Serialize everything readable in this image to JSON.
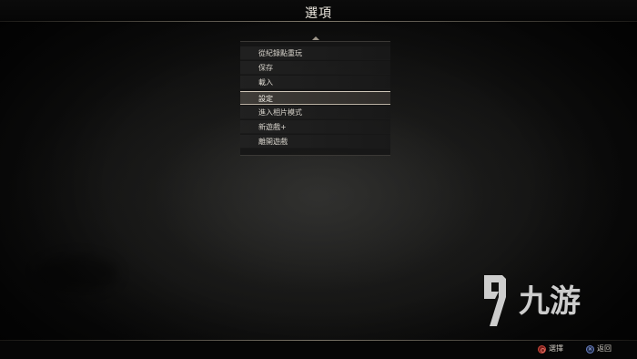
{
  "page": {
    "title": "選項"
  },
  "menu": {
    "items": [
      {
        "label": "從紀錄點重玩",
        "selected": false
      },
      {
        "label": "保存",
        "selected": false
      },
      {
        "label": "載入",
        "selected": false
      },
      {
        "label": "設定",
        "selected": true
      },
      {
        "label": "進入相片模式",
        "selected": false
      },
      {
        "label": "新遊戲+",
        "selected": false
      },
      {
        "label": "離開遊戲",
        "selected": false
      }
    ]
  },
  "hints": {
    "select_icon": "circle-button-icon",
    "select_label": "選擇",
    "back_icon": "cross-button-icon",
    "back_label": "返回"
  },
  "watermark": {
    "text": "九游"
  },
  "colors": {
    "background": "#050505",
    "selected_border": "#cfc6b8",
    "select_button": "#c9473c",
    "back_button": "#6a7fc0"
  }
}
